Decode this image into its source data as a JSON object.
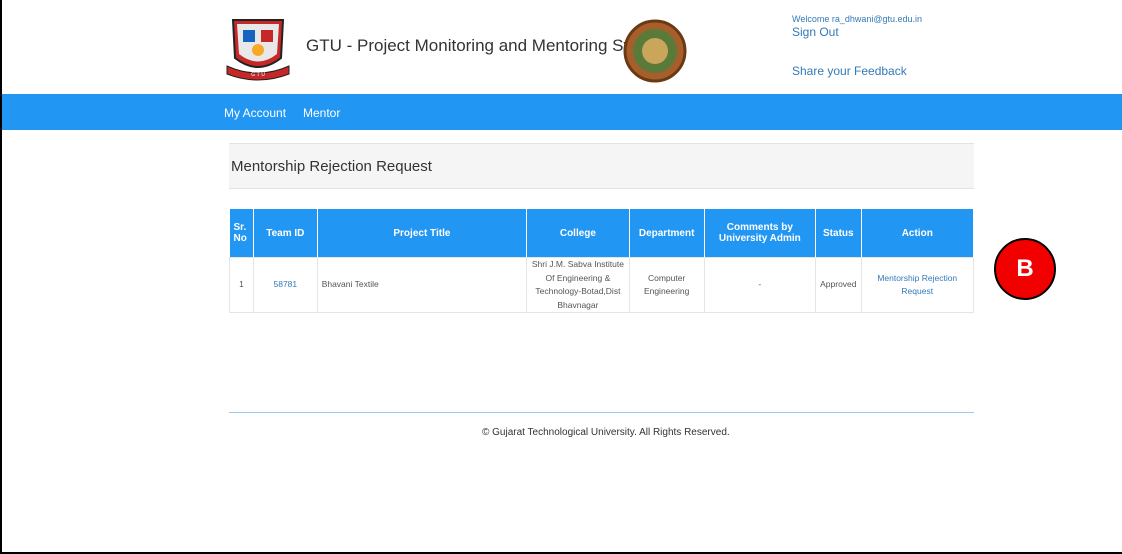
{
  "header": {
    "title": "GTU - Project Monitoring and Mentoring System",
    "welcome": "Welcome ra_dhwani@gtu.edu.in",
    "sign_out": "Sign Out",
    "feedback": "Share your Feedback"
  },
  "nav": {
    "items": [
      {
        "label": "My Account"
      },
      {
        "label": "Mentor"
      }
    ]
  },
  "page": {
    "title": "Mentorship Rejection Request"
  },
  "table": {
    "headers": [
      "Sr. No",
      "Team ID",
      "Project Title",
      "College",
      "Department",
      "Comments by University Admin",
      "Status",
      "Action"
    ],
    "rows": [
      {
        "sr": "1",
        "team_id": "58781",
        "project_title": "Bhavani Textile",
        "college": "Shri J.M. Sabva Institute Of Engineering & Technology-Botad,Dist Bhavnagar",
        "department": "Computer Engineering",
        "comments": "-",
        "status": "Approved",
        "action": "Mentorship Rejection Request"
      }
    ]
  },
  "footer": {
    "text": "© Gujarat Technological University. All Rights Reserved."
  },
  "annotation": {
    "label": "B"
  },
  "colors": {
    "primary": "#2196f3",
    "link": "#337ab7",
    "annotation": "#f20000"
  },
  "icons": {
    "left_logo": "gtu-crest-logo",
    "right_logo": "round-seal-logo"
  }
}
